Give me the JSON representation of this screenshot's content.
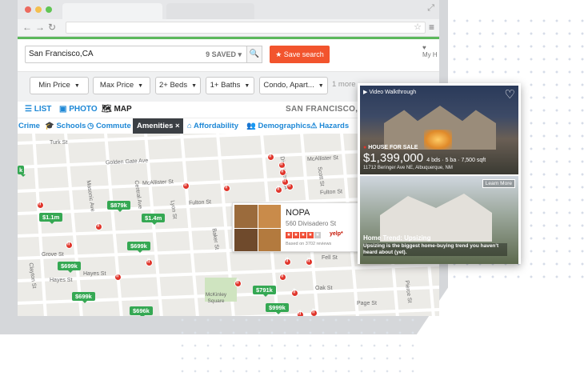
{
  "search": {
    "location": "San Francisco,CA",
    "saved": "9 SAVED ▾",
    "save_search_label": "★ Save search",
    "myhome_label": "My H"
  },
  "filters": [
    {
      "label": "Min Price"
    },
    {
      "label": "Max Price"
    },
    {
      "label": "2+ Beds"
    },
    {
      "label": "1+ Baths"
    },
    {
      "label": "Condo, Apart..."
    }
  ],
  "filters_more": "1 more",
  "views": {
    "list": "☰ LIST",
    "photo": "▣ PHOTO",
    "map": "🗺 MAP",
    "location_label": "SAN FRANCISCO, CA"
  },
  "layers": {
    "crime": "Crime",
    "schools": "Schools",
    "commute": "Commute",
    "amenities": "Amenities ×",
    "affordability": "Affordability",
    "demographics": "Demographics",
    "hazards": "Hazards"
  },
  "map": {
    "roads": {
      "turk": "Turk St",
      "golden_gate": "Golden Gate Ave",
      "mcallister_w": "McAllister St",
      "mcallister_e": "McAllister St",
      "fulton_w": "Fulton St",
      "fulton_e": "Fulton St",
      "grove": "Grove St",
      "hayes": "Hayes St",
      "fell": "Fell St",
      "oak": "Oak St",
      "page": "Page St",
      "masonic": "Masonic Ave",
      "central": "Central Ave",
      "lyon": "Lyon St",
      "baker": "Baker St",
      "divisadero": "Divisadero St",
      "scott": "Scott St",
      "clayton": "Clayton St",
      "pierce": "Pierce St",
      "page2": "Page St"
    },
    "park": "McKinley Square"
  },
  "prices": [
    {
      "value": "$879k"
    },
    {
      "value": "$1.1m"
    },
    {
      "value": "$1.4m"
    },
    {
      "value": "$699k"
    },
    {
      "value": "$699k"
    },
    {
      "value": "$699k"
    },
    {
      "value": "$696k"
    },
    {
      "value": "$791k"
    },
    {
      "value": "$999k"
    }
  ],
  "nopa": {
    "name": "NOPA",
    "address": "560 Divisadero St",
    "yelp": "yelp*",
    "reviews": "Based on 3702 reviews"
  },
  "card1": {
    "walkthrough": "▶ Video Walkthrough",
    "status": "HOUSE FOR SALE",
    "price": "$1,399,000",
    "specs": "4 bds · 5 ba · 7,500 sqft",
    "address": "11712 Beringer Ave NE, Albuquerque, NM"
  },
  "card2": {
    "learn_more": "Learn More",
    "title": "Home Trend: Upsizing",
    "text": "Upsizing is the biggest home-buying trend you haven't heard about (yet)."
  },
  "colors": {
    "accent": "#f2542d",
    "green": "#35a853",
    "link": "#1e88d6",
    "pin": "#e0352b"
  },
  "icons": [
    "back-icon",
    "forward-icon",
    "reload-icon",
    "star-icon",
    "menu-icon",
    "search-icon",
    "heart-icon",
    "play-icon"
  ]
}
